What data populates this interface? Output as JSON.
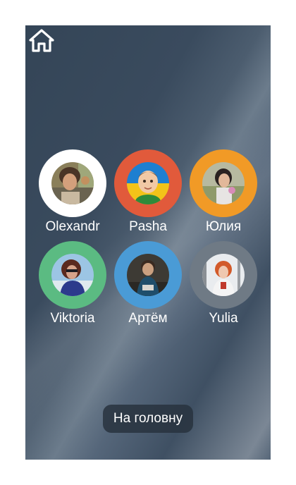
{
  "home_icon": "home-icon",
  "contacts": [
    {
      "name": "Olexandr",
      "ring_color": "#ffffff",
      "avatar": "photo-man-curly-hair"
    },
    {
      "name": "Pasha",
      "ring_color": "#e15a3b",
      "avatar": "cartoon-boy-ukraine-flag"
    },
    {
      "name": "Юлия",
      "ring_color": "#f19a26",
      "avatar": "photo-woman-outdoor"
    },
    {
      "name": "Viktoria",
      "ring_color": "#5bbb82",
      "avatar": "photo-woman-sunglasses"
    },
    {
      "name": "Артём",
      "ring_color": "#4a9bd6",
      "avatar": "photo-young-man"
    },
    {
      "name": "Yulia",
      "ring_color": "#6f7a85",
      "avatar": "photo-woman-red-hair"
    }
  ],
  "bottom_button": {
    "label": "На головну"
  }
}
